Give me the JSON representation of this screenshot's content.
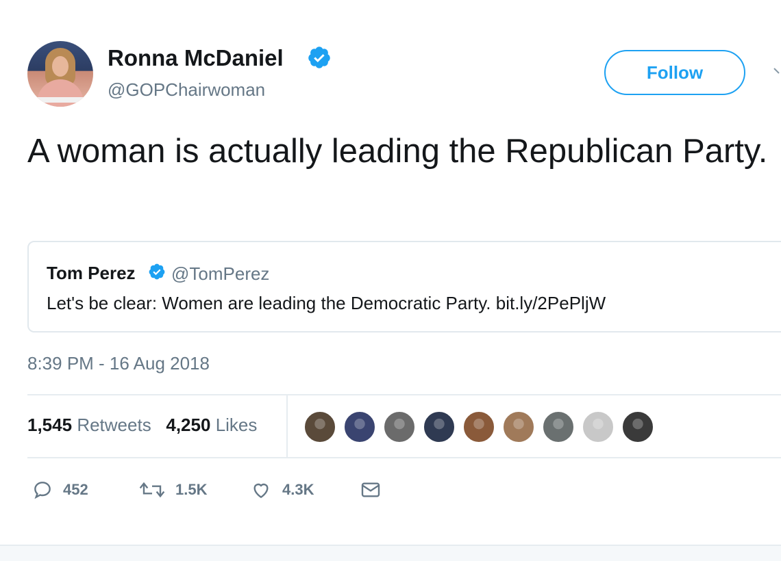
{
  "author": {
    "name": "Ronna McDaniel",
    "handle": "@GOPChairwoman",
    "avatar_icon": "profile-photo"
  },
  "follow_label": "Follow",
  "tweet_text": "A woman is actually leading the Republican Party.",
  "quoted_tweet": {
    "name": "Tom Perez",
    "handle": "@TomPerez",
    "text": "Let's be clear: Women are leading the Democratic Party. bit.ly/2PePljW"
  },
  "timestamp": "8:39 PM - 16 Aug 2018",
  "stats": {
    "retweets_count": "1,545",
    "retweets_label": "Retweets",
    "likes_count": "4,250",
    "likes_label": "Likes"
  },
  "liker_avatars": [
    {
      "color": "#5a4a3a"
    },
    {
      "color": "#3a4470"
    },
    {
      "color": "#6b6b6b"
    },
    {
      "color": "#2f3a52"
    },
    {
      "color": "#8a5a3a"
    },
    {
      "color": "#a07a5a"
    },
    {
      "color": "#6a7070"
    },
    {
      "color": "#c8c8c8"
    },
    {
      "color": "#3a3a3a"
    }
  ],
  "actions": {
    "replies": "452",
    "retweets": "1.5K",
    "likes": "4.3K"
  },
  "colors": {
    "brand_blue": "#1da1f2",
    "secondary_text": "#657786",
    "primary_text": "#14171a",
    "border": "#e1e8ed"
  }
}
